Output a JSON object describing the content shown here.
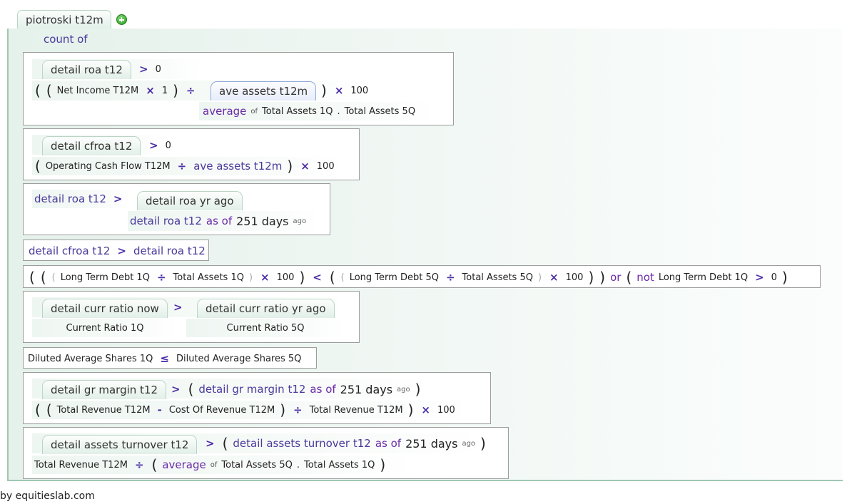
{
  "main": {
    "tab_label": "piotroski t12m",
    "count_of": "count of",
    "footer": "by equitieslab.com"
  },
  "rule1": {
    "tab": "detail roa t12",
    "gt": ">",
    "zero": "0",
    "open": "(",
    "close": ")",
    "net_income": "Net Income T12M",
    "times": "×",
    "one": "1",
    "divide": "÷",
    "ave_tab": "ave assets t12m",
    "hundred": "100",
    "average": "average",
    "of": "of",
    "ta1q": "Total Assets 1Q",
    "dot": ".",
    "ta5q": "Total Assets 5Q"
  },
  "rule2": {
    "tab": "detail cfroa t12",
    "gt": ">",
    "zero": "0",
    "open": "(",
    "ocf": "Operating Cash Flow T12M",
    "divide": "÷",
    "ave": "ave assets t12m",
    "close": ")",
    "times": "×",
    "hundred": "100"
  },
  "rule3": {
    "left": "detail roa t12",
    "gt": ">",
    "tab": "detail roa yr ago",
    "ref": "detail roa t12",
    "asof": "as of",
    "days": "251 days",
    "ago": "ago"
  },
  "rule4": {
    "left": "detail cfroa t12",
    "gt": ">",
    "right": "detail roa t12"
  },
  "rule5": {
    "open": "(",
    "close": ")",
    "ltd1q": "Long Term Debt 1Q",
    "divide": "÷",
    "ta1q": "Total Assets 1Q",
    "times": "×",
    "hundred": "100",
    "lt": "<",
    "ltd5q": "Long Term Debt 5Q",
    "ta5q": "Total Assets 5Q",
    "or": "or",
    "not": "not",
    "gt": ">",
    "zero": "0"
  },
  "rule6": {
    "tab_now": "detail curr ratio now",
    "gt": ">",
    "tab_ago": "detail curr ratio yr ago",
    "cr1q": "Current Ratio 1Q",
    "cr5q": "Current Ratio 5Q"
  },
  "rule7": {
    "left": "Diluted Average Shares 1Q",
    "le": "≤",
    "right": "Diluted Average Shares 5Q"
  },
  "rule8": {
    "tab": "detail gr margin t12",
    "gt": ">",
    "open": "(",
    "close": ")",
    "ref": "detail gr margin t12",
    "asof": "as of",
    "days": "251 days",
    "ago": "ago",
    "rev": "Total Revenue T12M",
    "minus": "-",
    "cost": "Cost Of Revenue T12M",
    "divide": "÷",
    "times": "×",
    "hundred": "100"
  },
  "rule9": {
    "tab": "detail assets turnover t12",
    "gt": ">",
    "open": "(",
    "close": ")",
    "ref": "detail assets turnover t12",
    "asof": "as of",
    "days": "251 days",
    "ago": "ago",
    "rev": "Total Revenue T12M",
    "divide": "÷",
    "average": "average",
    "of": "of",
    "ta5q": "Total Assets 5Q",
    "dot": ".",
    "ta1q": "Total Assets 1Q"
  },
  "colors": {
    "operator": "#4b2da8",
    "reference": "#4a3a9c",
    "tab_border": "#b9d5c6",
    "add_icon": "#2e9b27"
  }
}
